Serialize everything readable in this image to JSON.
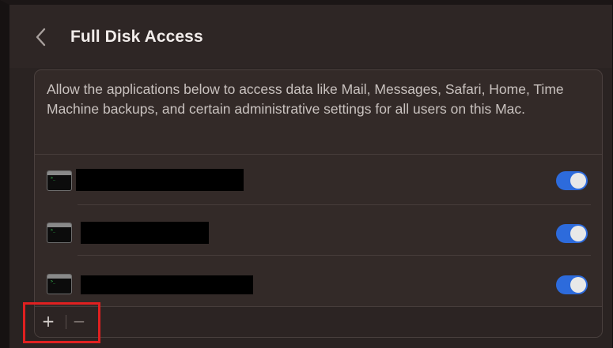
{
  "header": {
    "back_icon": "chevron-left-icon",
    "title": "Full Disk Access"
  },
  "panel": {
    "description": "Allow the applications below to access data like Mail, Messages, Safari, Home, Time Machine backups, and certain administrative settings for all users on this Mac.",
    "apps": [
      {
        "icon": "terminal-icon",
        "name": "",
        "name_redacted": true,
        "enabled": true
      },
      {
        "icon": "terminal-icon",
        "name": "",
        "name_redacted": true,
        "enabled": true
      },
      {
        "icon": "terminal-icon",
        "name": "",
        "name_redacted": true,
        "enabled": true
      }
    ]
  },
  "footer": {
    "add_label": "+",
    "remove_label": "−"
  },
  "colors": {
    "toggle_on": "#2d6bdc",
    "highlight": "#e02020",
    "background": "#2a2322"
  }
}
